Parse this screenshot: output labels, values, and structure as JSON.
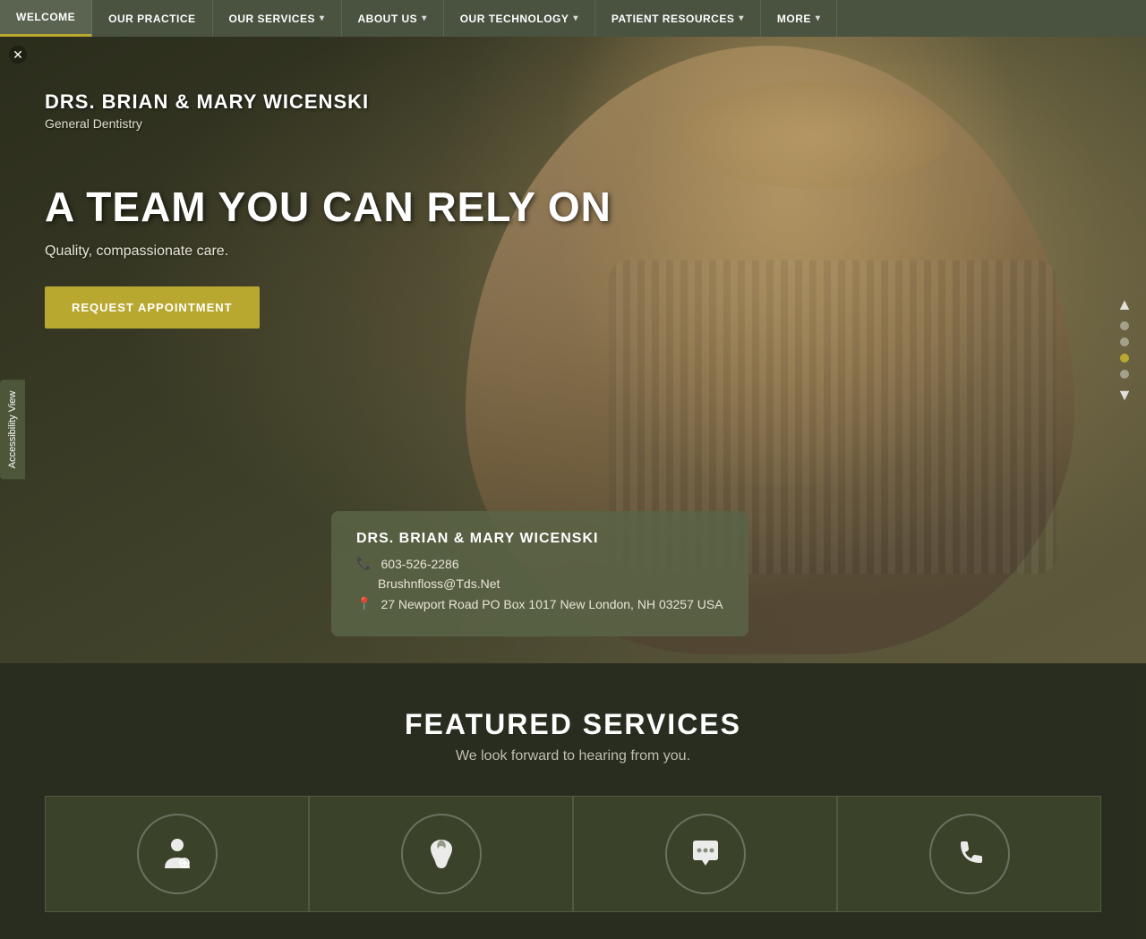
{
  "nav": {
    "items": [
      {
        "label": "WELCOME",
        "active": true,
        "hasDropdown": false
      },
      {
        "label": "OUR PRACTICE",
        "active": false,
        "hasDropdown": false
      },
      {
        "label": "OUR SERVICES",
        "active": false,
        "hasDropdown": true
      },
      {
        "label": "ABOUT US",
        "active": false,
        "hasDropdown": true
      },
      {
        "label": "OUR TECHNOLOGY",
        "active": false,
        "hasDropdown": true
      },
      {
        "label": "PATIENT RESOURCES",
        "active": false,
        "hasDropdown": true
      },
      {
        "label": "MORE",
        "active": false,
        "hasDropdown": true
      }
    ]
  },
  "hero": {
    "practice_name": "DRS. BRIAN & MARY WICENSKI",
    "practice_type": "General Dentistry",
    "headline": "A TEAM YOU CAN RELY ON",
    "tagline": "Quality, compassionate care.",
    "cta_button": "REQUEST APPOINTMENT"
  },
  "contact_card": {
    "name": "DRS. BRIAN & MARY WICENSKI",
    "phone": "603-526-2286",
    "email": "Brushnfloss@Tds.Net",
    "address": "27 Newport Road PO Box 1017 New London, NH 03257 USA"
  },
  "accessibility": {
    "label": "Accessibility View"
  },
  "featured": {
    "title": "FEATURED SERVICES",
    "subtitle": "We look forward to hearing from you.",
    "services": [
      {
        "icon": "👨‍⚕️",
        "label": "Doctor"
      },
      {
        "icon": "🦷",
        "label": "Dental"
      },
      {
        "icon": "💬",
        "label": "Consultation"
      },
      {
        "icon": "📞",
        "label": "Contact"
      }
    ]
  },
  "side_dots": [
    {
      "active": false
    },
    {
      "active": false
    },
    {
      "active": true
    },
    {
      "active": false
    }
  ]
}
